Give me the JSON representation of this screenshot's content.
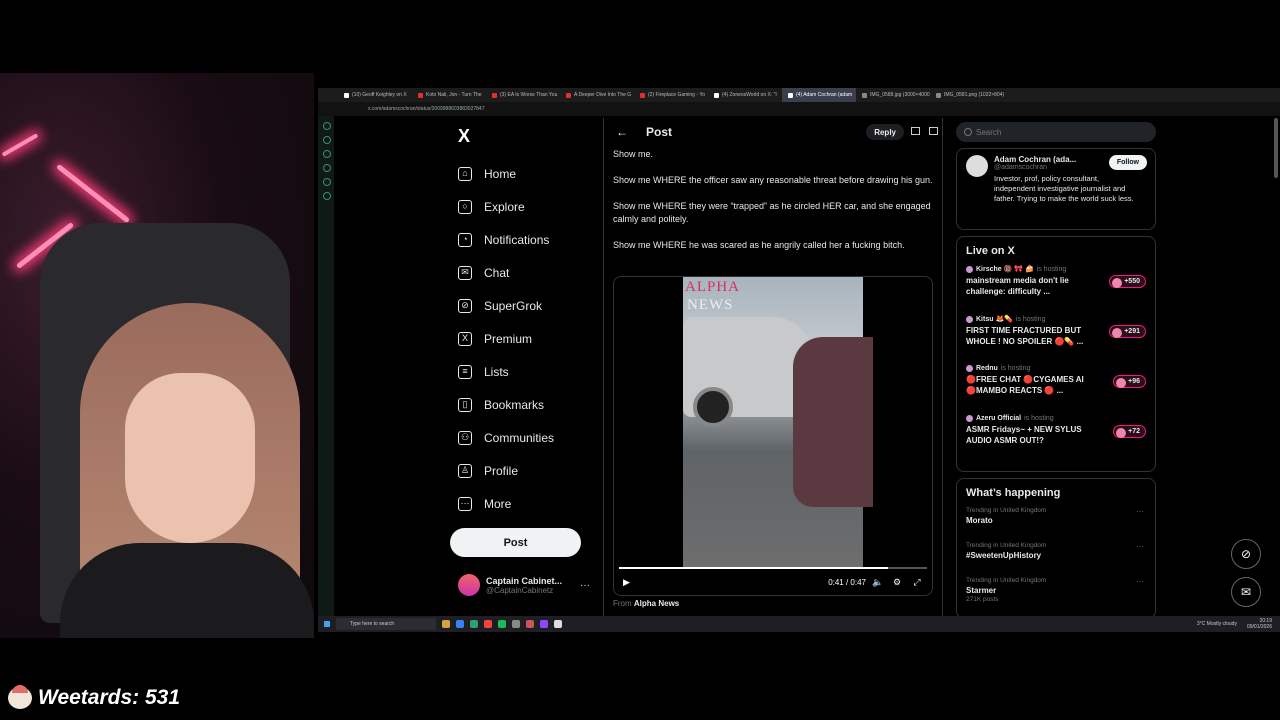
{
  "browser": {
    "tabs": [
      {
        "label": "(10) Geoff Keighley on X",
        "color": "#ffffff"
      },
      {
        "label": "Koto Nali, Jon - Turn The",
        "color": "#e03030"
      },
      {
        "label": "(3) EA Is Worse Than You",
        "color": "#e03030"
      },
      {
        "label": "A Deeper Dive Into The G",
        "color": "#e03030"
      },
      {
        "label": "(2) Fireplace Gaming - Yo",
        "color": "#e03030"
      },
      {
        "label": "(4) ZoneosWorld on X: \"I",
        "color": "#ffffff"
      },
      {
        "label": "(4) Adam Cochran (adam",
        "color": "#ffffff",
        "active": true
      },
      {
        "label": "IMG_0588.jpg (3000×4000)",
        "color": "#888888"
      },
      {
        "label": "IMG_0581.png (1022×804)",
        "color": "#888888"
      }
    ],
    "url": "x.com/adamscochran/status/2009988603883027847"
  },
  "nav": {
    "logo": "X",
    "items": [
      {
        "label": "Home",
        "icon": "home-icon",
        "glyph": "⌂"
      },
      {
        "label": "Explore",
        "icon": "search-icon",
        "glyph": "○"
      },
      {
        "label": "Notifications",
        "icon": "bell-icon",
        "glyph": "◔"
      },
      {
        "label": "Chat",
        "icon": "mail-icon",
        "glyph": "✉"
      },
      {
        "label": "SuperGrok",
        "icon": "grok-icon",
        "glyph": "⊘"
      },
      {
        "label": "Premium",
        "icon": "x-premium-icon",
        "glyph": "X"
      },
      {
        "label": "Lists",
        "icon": "list-icon",
        "glyph": "≡"
      },
      {
        "label": "Bookmarks",
        "icon": "bookmark-icon",
        "glyph": "▯"
      },
      {
        "label": "Communities",
        "icon": "communities-icon",
        "glyph": "⚇"
      },
      {
        "label": "Profile",
        "icon": "person-icon",
        "glyph": "♙"
      },
      {
        "label": "More",
        "icon": "more-circle-icon",
        "glyph": "⋯"
      }
    ],
    "post_label": "Post",
    "account": {
      "name": "Captain Cabinet...",
      "handle": "@CaptainCabinetz",
      "more": "···"
    }
  },
  "post": {
    "header_title": "Post",
    "back": "←",
    "reply_label": "Reply",
    "paragraphs": [
      "Show me.",
      "Show me WHERE the officer saw any reasonable threat before drawing his gun.",
      "Show me WHERE they were “trapped” as he circled HER car, and she engaged calmly and politely.",
      "Show me WHERE he was scared as he angrily called her a fucking bitch."
    ],
    "video": {
      "watermark_top": "ALPHA",
      "watermark_bottom": "NEWS",
      "time": "0:41 / 0:47",
      "progress": 0.872,
      "play": "▶",
      "volume": "🔈",
      "settings": "⚙",
      "fullscreen": "⤢"
    },
    "from_prefix": "From",
    "from_source": "Alpha News"
  },
  "sidebar": {
    "search_placeholder": "Search",
    "profile": {
      "name": "Adam Cochran (ada...",
      "handle": "@adamscochran",
      "bio": "Investor, prof, policy consultant, independent investigative journalist and father. Trying to make the world suck less.",
      "follow_label": "Follow"
    },
    "live_title": "Live on X",
    "live": [
      {
        "host": "Kirsche 🔞 🎀 🍰",
        "status": "is hosting",
        "title": "mainstream media don't lie challenge: difficulty ...",
        "count": "+550"
      },
      {
        "host": "Kitsu 🦊💊",
        "status": "is hosting",
        "title": "FIRST TIME FRACTURED BUT WHOLE ! NO SPOILER 🔴💊 ...",
        "count": "+291"
      },
      {
        "host": "Rednu",
        "status": "is hosting",
        "title": "🔴FREE CHAT 🔴CYGAMES AI 🔴MAMBO REACTS 🔴 ...",
        "count": "+96"
      },
      {
        "host": "Azeru Official",
        "status": "is hosting",
        "title": "ASMR Fridays~ + NEW SYLUS AUDIO ASMR OUT!?",
        "count": "+72"
      }
    ],
    "trends_title": "What’s happening",
    "trends": [
      {
        "meta": "Trending in United Kingdom",
        "name": "Morato",
        "posts": ""
      },
      {
        "meta": "Trending in United Kingdom",
        "name": "#SweetenUpHistory",
        "posts": ""
      },
      {
        "meta": "Trending in United Kingdom",
        "name": "Starmer",
        "posts": "271K posts"
      }
    ],
    "more": "···"
  },
  "taskbar": {
    "search_placeholder": "Type here to search",
    "weather": "3°C  Mostly cloudy",
    "time": "20:19",
    "date": "09/01/2026"
  },
  "overlay": {
    "counter_label": "Weetards: 531"
  }
}
